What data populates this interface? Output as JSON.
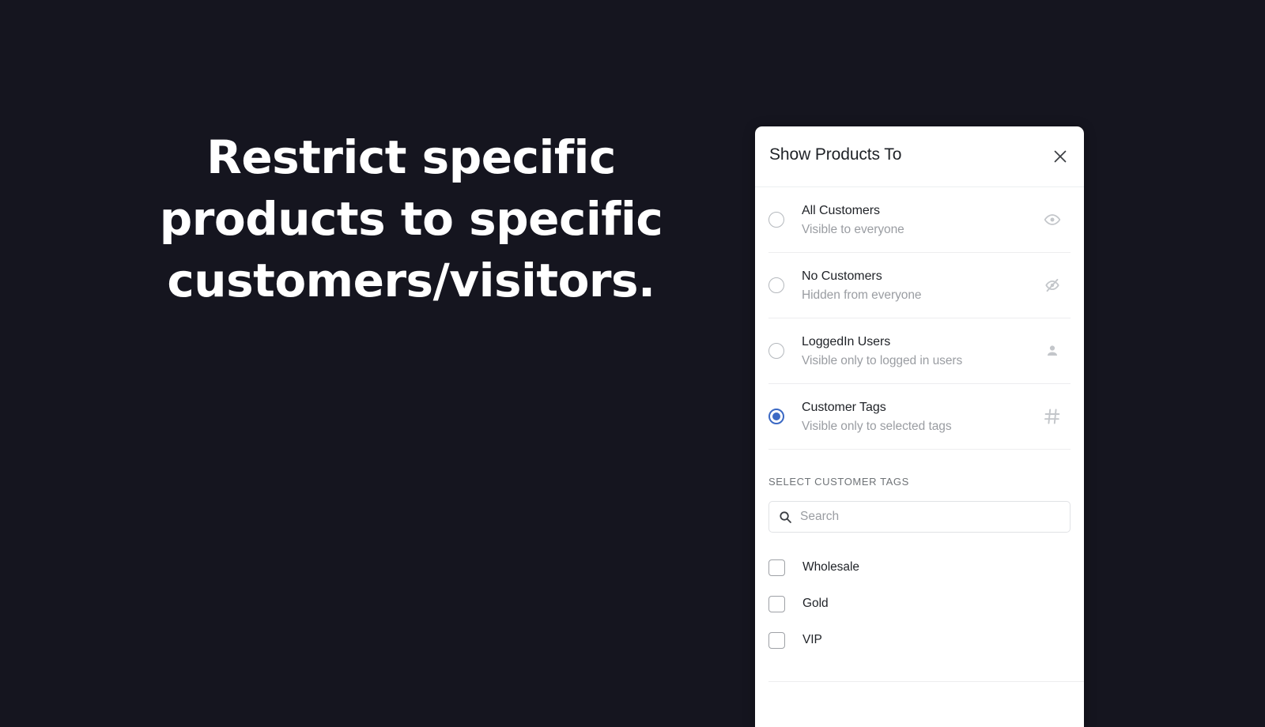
{
  "background_color": "#15151f",
  "accent_color": "#3b69c4",
  "headline": {
    "line1": "Restrict specific",
    "line2": "products to specific",
    "line3": "customers/visitors."
  },
  "panel": {
    "title": "Show Products To",
    "close_icon": "close-icon",
    "options": [
      {
        "label": "All Customers",
        "description": "Visible to everyone",
        "icon": "eye-icon",
        "selected": false
      },
      {
        "label": "No Customers",
        "description": "Hidden from everyone",
        "icon": "eye-off-icon",
        "selected": false
      },
      {
        "label": "LoggedIn Users",
        "description": "Visible only to logged in users",
        "icon": "person-icon",
        "selected": false
      },
      {
        "label": "Customer Tags",
        "description": "Visible only to selected tags",
        "icon": "hash-icon",
        "selected": true
      }
    ],
    "tags_section": {
      "label": "SELECT CUSTOMER TAGS",
      "search": {
        "icon": "search-icon",
        "value": "",
        "placeholder": "Search"
      },
      "tags": [
        {
          "label": "Wholesale",
          "checked": false
        },
        {
          "label": "Gold",
          "checked": false
        },
        {
          "label": "VIP",
          "checked": false
        }
      ]
    }
  }
}
